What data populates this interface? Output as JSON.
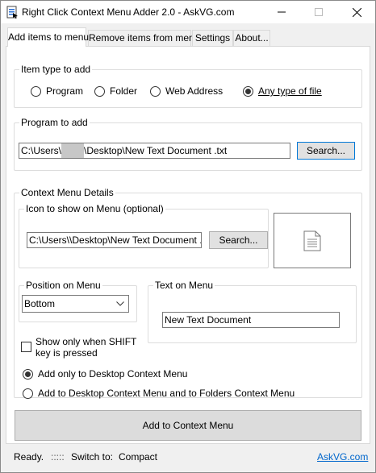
{
  "window": {
    "title": "Right Click Context Menu Adder 2.0 - AskVG.com"
  },
  "tabs": [
    {
      "label": "Add items to menu"
    },
    {
      "label": "Remove items from menu"
    },
    {
      "label": "Settings"
    },
    {
      "label": "About..."
    }
  ],
  "item_type": {
    "label": "Item type to add",
    "options": [
      {
        "label": "Program",
        "checked": false
      },
      {
        "label": "Folder",
        "checked": false
      },
      {
        "label": "Web Address",
        "checked": false
      },
      {
        "label": "Any type of file",
        "checked": true
      }
    ]
  },
  "program": {
    "label": "Program to add",
    "path_prefix": "C:\\Users\\",
    "path_suffix": "\\Desktop\\New Text Document .txt",
    "browse_label": "Search..."
  },
  "details": {
    "label": "Context Menu Details",
    "icon_group_label": "Icon to show on Menu (optional)",
    "icon_path_prefix": "C:\\Users\\",
    "icon_path_suffix": "\\Desktop\\New Text Document .txt",
    "icon_browse_label": "Search...",
    "position_label": "Position on Menu",
    "position_value": "Bottom",
    "text_label": "Text on Menu",
    "text_value": "New Text Document",
    "shift_label_line1": "Show only when SHIFT",
    "shift_label_line2": "key is pressed",
    "shift_checked": false,
    "scope_options": [
      {
        "label": "Add only to Desktop Context Menu",
        "checked": true
      },
      {
        "label": "Add to Desktop Context Menu and to Folders Context Menu",
        "checked": false
      }
    ]
  },
  "add_button_label": "Add to Context Menu",
  "status": {
    "text": "Ready.",
    "grip": ":::::",
    "switch_label": "Switch to:",
    "switch_value": "Compact",
    "site_link": "AskVG.com"
  }
}
